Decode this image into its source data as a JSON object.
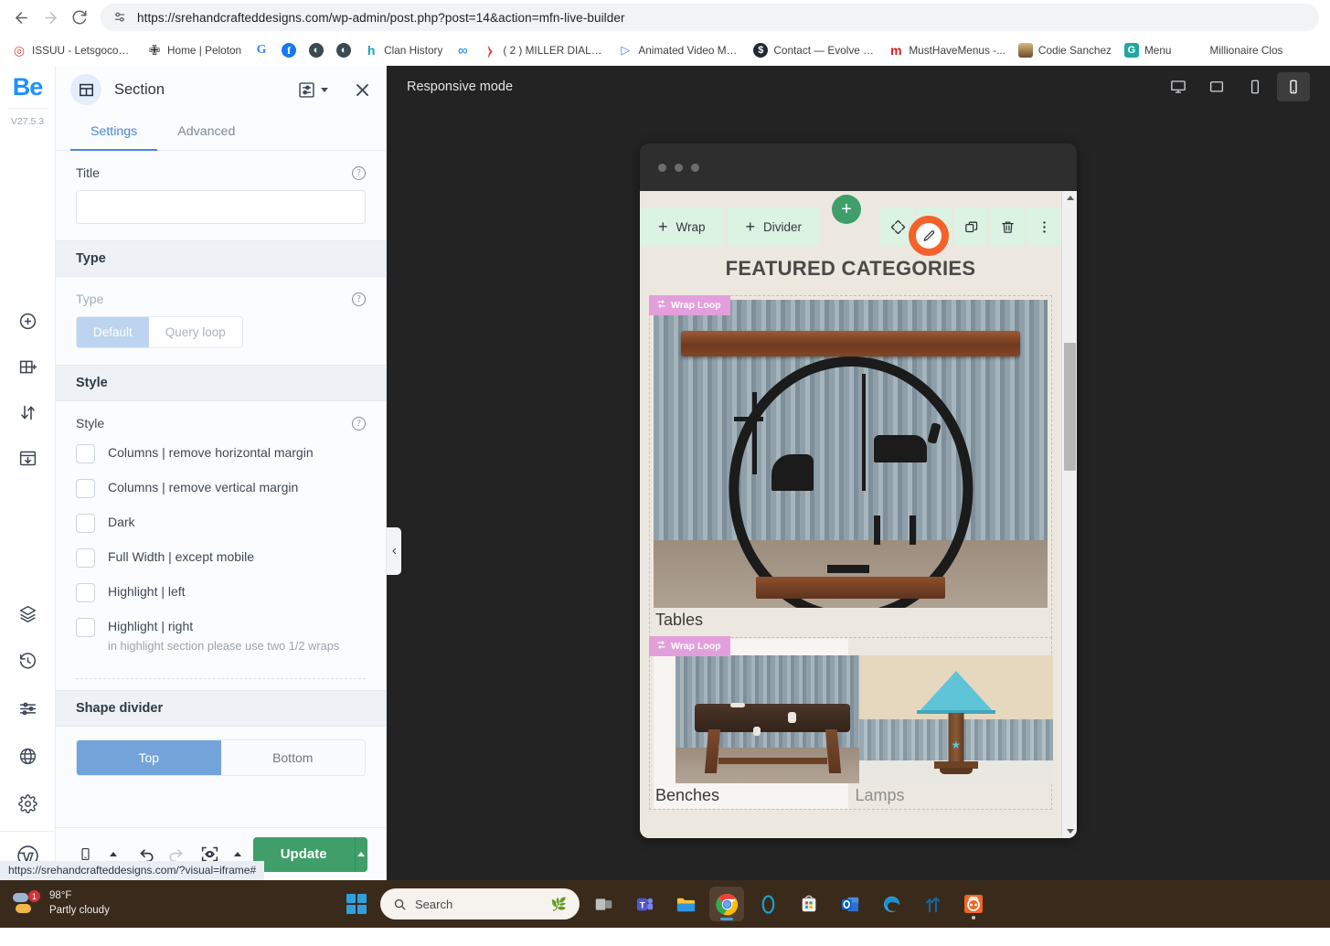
{
  "browser": {
    "back_icon": "back-arrow-icon",
    "forward_icon": "forward-arrow-icon",
    "reload_icon": "reload-icon",
    "site_info_icon": "site-settings-icon",
    "url": "https://srehandcrafteddesigns.com/wp-admin/post.php?post=14&action=mfn-live-builder",
    "bookmarks": [
      {
        "label": "ISSUU - Letsgocoup...",
        "icon": "issuu-icon",
        "color": "#e8453c",
        "glyph": "◎"
      },
      {
        "label": "Home | Peloton",
        "icon": "peloton-icon",
        "color": "#1d1d1d",
        "glyph": "✙"
      },
      {
        "label": "",
        "icon": "google-icon",
        "color": "#4285f4",
        "glyph": "G"
      },
      {
        "label": "",
        "icon": "facebook-icon",
        "color": "#1877f2",
        "glyph": "f"
      },
      {
        "label": "",
        "icon": "globe-dark-icon",
        "color": "#3b4a52",
        "glyph": "◔"
      },
      {
        "label": "",
        "icon": "globe-dark-icon-2",
        "color": "#3b4a52",
        "glyph": "◔"
      },
      {
        "label": "Clan History",
        "icon": "clan-history-icon",
        "color": "#1aa3b8",
        "glyph": "h"
      },
      {
        "label": "",
        "icon": "meta-icon",
        "color": "#0081fb",
        "glyph": "∞"
      },
      {
        "label": "( 2 ) MILLER DIALAR...",
        "icon": "zoho-icon",
        "color": "#e42527",
        "glyph": "⫽"
      },
      {
        "label": "Animated Video Ma...",
        "icon": "animated-video-icon",
        "color": "#3b82f6",
        "glyph": "▷"
      },
      {
        "label": "Contact — Evolve H...",
        "icon": "evolve-icon",
        "color": "#222831",
        "glyph": "$"
      },
      {
        "label": "MustHaveMenus -...",
        "icon": "musthavemenus-icon",
        "color": "#d32027",
        "glyph": "m"
      },
      {
        "label": "Codie Sanchez",
        "icon": "codie-sanchez-avatar",
        "color": "#c9a227",
        "glyph": "●"
      },
      {
        "label": "Menu",
        "icon": "grammarly-icon",
        "color": "#1fa7a0",
        "glyph": "G"
      },
      {
        "label": "Millionaire Clos",
        "icon": "",
        "color": "",
        "glyph": ""
      }
    ]
  },
  "builder": {
    "logo": "Be",
    "version": "V27.5.3",
    "rail_top": [
      {
        "name": "add-item-icon"
      },
      {
        "name": "add-layout-icon"
      },
      {
        "name": "reorder-icon"
      },
      {
        "name": "import-template-icon"
      }
    ],
    "rail_bottom": [
      {
        "name": "layers-icon"
      },
      {
        "name": "history-icon"
      },
      {
        "name": "options-icon"
      },
      {
        "name": "globe-icon"
      },
      {
        "name": "settings-gear-icon"
      }
    ],
    "rail_wordpress": "wordpress-icon",
    "panel": {
      "icon": "section-icon",
      "title": "Section",
      "preset_icon": "presets-icon",
      "close_icon": "close-icon",
      "tabs": [
        {
          "label": "Settings",
          "active": true
        },
        {
          "label": "Advanced",
          "active": false
        }
      ],
      "title_field": {
        "label": "Title",
        "value": "",
        "placeholder": "",
        "help_icon": "help-icon"
      },
      "type_section": {
        "heading": "Type",
        "label": "Type",
        "help_icon": "help-icon",
        "options": [
          {
            "label": "Default",
            "selected": true
          },
          {
            "label": "Query loop",
            "selected": false
          }
        ]
      },
      "style_section": {
        "heading": "Style",
        "label": "Style",
        "help_icon": "help-icon",
        "checkboxes": [
          {
            "label": "Columns | remove horizontal margin",
            "checked": false,
            "sub": ""
          },
          {
            "label": "Columns | remove vertical margin",
            "checked": false,
            "sub": ""
          },
          {
            "label": "Dark",
            "checked": false,
            "sub": ""
          },
          {
            "label": "Full Width | except mobile",
            "checked": false,
            "sub": ""
          },
          {
            "label": "Highlight | left",
            "checked": false,
            "sub": ""
          },
          {
            "label": "Highlight | right",
            "checked": false,
            "sub": "in highlight section please use two 1/2 wraps"
          }
        ]
      },
      "shape_divider": {
        "heading": "Shape divider",
        "options": [
          {
            "label": "Top",
            "selected": true
          },
          {
            "label": "Bottom",
            "selected": false
          }
        ]
      },
      "footer": {
        "device_icon": "mobile-preview-icon",
        "device_caret": "caret-up-icon",
        "undo_icon": "undo-icon",
        "redo_icon": "redo-icon",
        "preview_icon": "preview-eye-icon",
        "preview_caret": "caret-up-icon",
        "update_label": "Update",
        "update_caret": "caret-up-icon"
      },
      "collapse_icon": "chevron-left-icon"
    },
    "status_url": "https://srehandcrafteddesigns.com/?visual=iframe#",
    "canvas": {
      "responsive_label": "Responsive mode",
      "devices": [
        {
          "name": "desktop-view",
          "active": false
        },
        {
          "name": "tablet-view",
          "active": false
        },
        {
          "name": "tablet-portrait-view",
          "active": false
        },
        {
          "name": "mobile-view",
          "active": true
        }
      ],
      "toolbar": {
        "wrap_label": "Wrap",
        "divider_label": "Divider",
        "add_plus": "+",
        "actions": [
          {
            "name": "move-icon"
          },
          {
            "name": "edit-pencil-icon",
            "highlighted": true,
            "accent": "#f4622a"
          },
          {
            "name": "duplicate-icon"
          },
          {
            "name": "delete-trash-icon"
          },
          {
            "name": "more-options-icon"
          }
        ]
      },
      "page": {
        "heading": "FEATURED CATEGORIES",
        "loop_tag": "Wrap Loop",
        "loop_tag_icon": "loop-icon",
        "categories": [
          {
            "name": "Tables",
            "image": "live-edge-wood-table-with-cross-and-horse-metal-art",
            "muted": false
          },
          {
            "name": "Benches",
            "image": "cowhide-topped-wooden-bench",
            "muted": false
          },
          {
            "name": "Lamps",
            "image": "turquoise-shade-rustic-table-lamp-with-star",
            "muted": true
          }
        ]
      },
      "scrollbar": {
        "up_icon": "scroll-up-arrow",
        "down_icon": "scroll-down-arrow"
      }
    }
  },
  "taskbar": {
    "weather": {
      "temperature": "98°F",
      "condition": "Partly cloudy",
      "badge": "1",
      "icon": "partly-cloudy-icon"
    },
    "start_icon": "windows-start-icon",
    "search": {
      "placeholder": "Search",
      "icon": "search-icon",
      "decoration": "copilot-doodle-icon"
    },
    "apps": [
      {
        "name": "task-view-icon",
        "color": "#c8c8c8",
        "glyph": "▧"
      },
      {
        "name": "microsoft-teams-icon",
        "color": "#5059c9",
        "glyph": "T"
      },
      {
        "name": "file-explorer-icon",
        "color": "#ffbf3c",
        "glyph": "▬"
      },
      {
        "name": "google-chrome-icon",
        "color": "#4285f4",
        "glyph": "●",
        "active": true
      },
      {
        "name": "microsoft-copilot-icon",
        "color": "#15a6e0",
        "glyph": "○"
      },
      {
        "name": "microsoft-store-icon",
        "color": "#e8e8e8",
        "glyph": "▤"
      },
      {
        "name": "microsoft-outlook-icon",
        "color": "#0a6ed1",
        "glyph": "O"
      },
      {
        "name": "microsoft-edge-icon",
        "color": "#2aa4db",
        "glyph": "◑"
      },
      {
        "name": "upward-arrows-icon",
        "color": "#1464a0",
        "glyph": "⇈"
      },
      {
        "name": "orange-app-icon",
        "color": "#f26522",
        "glyph": "◎",
        "dot": true
      }
    ]
  }
}
